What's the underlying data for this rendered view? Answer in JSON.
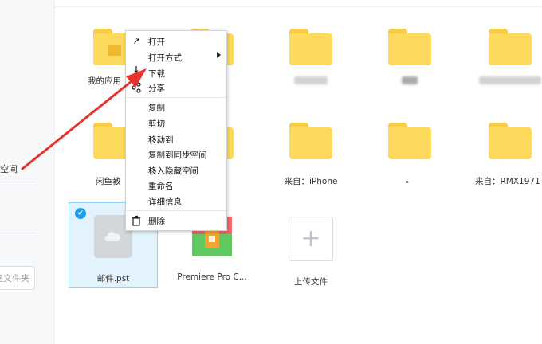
{
  "sidebar": {
    "space_label": "空间",
    "new_folder_label": "建文件夹"
  },
  "items": [
    {
      "label": "我的应用",
      "blurred": false
    },
    {
      "label": "",
      "blurred": true
    },
    {
      "label": "",
      "blurred": true
    },
    {
      "label": "",
      "blurred": true
    },
    {
      "label": "闲鱼教",
      "blurred": false
    },
    {
      "label": "来自：iPhone",
      "blurred": false
    },
    {
      "label": "。",
      "blurred": false
    },
    {
      "label": "来自：RMX1971",
      "blurred": false
    }
  ],
  "files": {
    "mail_pst": "邮件.pst",
    "premiere": "Premiere Pro C...",
    "upload": "上传文件",
    "upload_icon": "+",
    "check_icon": "✔"
  },
  "context_menu": {
    "open": "打开",
    "open_with": "打开方式",
    "download": "下载",
    "share": "分享",
    "copy": "复制",
    "cut": "剪切",
    "move_to": "移动到",
    "copy_to_sync": "复制到同步空间",
    "move_to_hidden": "移入隐藏空间",
    "rename": "重命名",
    "details": "详细信息",
    "delete": "删除",
    "icons": {
      "open": "↗",
      "download": "↓",
      "share": "share-icon",
      "delete": "trash-icon"
    }
  },
  "colors": {
    "folder": "#fdd95c",
    "accent": "#1e9cf0",
    "annotation": "#e8322e",
    "selection_bg": "#e3f3fd"
  }
}
